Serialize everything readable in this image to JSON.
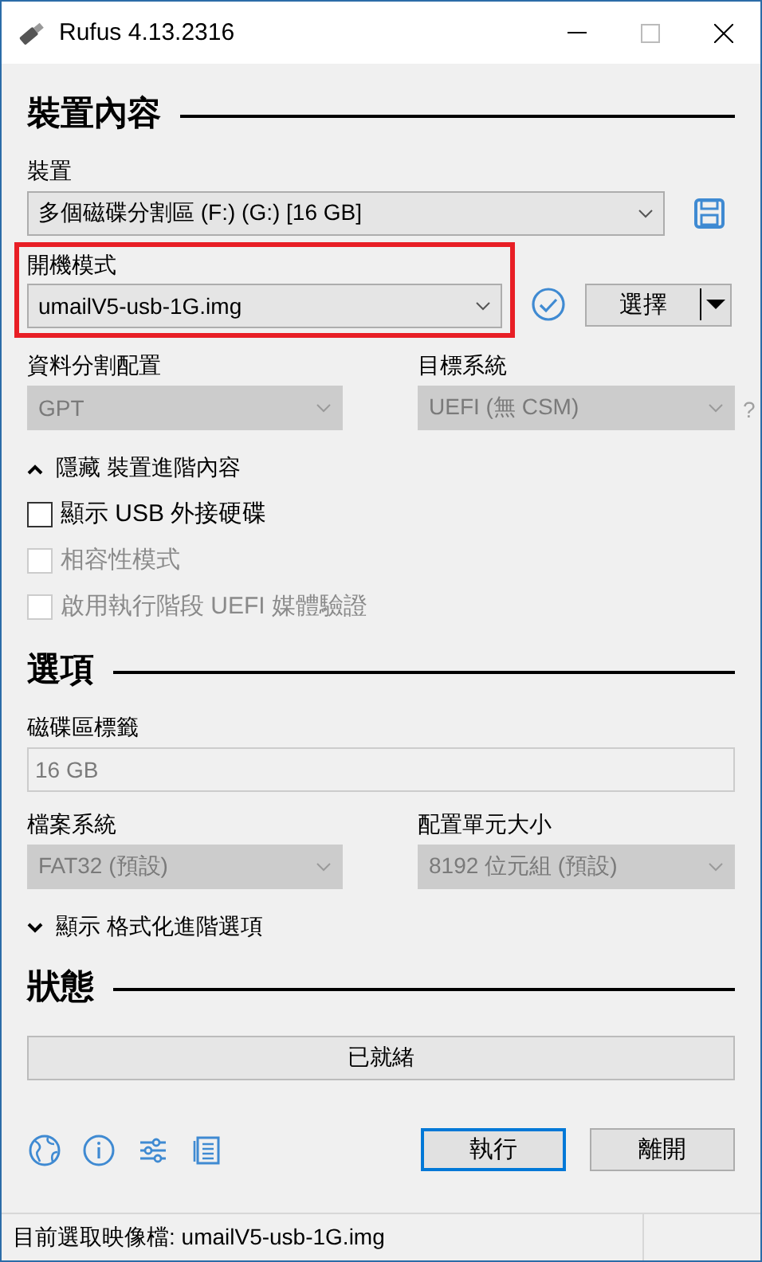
{
  "window": {
    "title": "Rufus 4.13.2316"
  },
  "drive_properties": {
    "heading": "裝置內容",
    "device": {
      "label": "裝置",
      "value": "多個磁碟分割區 (F:) (G:) [16 GB]"
    },
    "boot_selection": {
      "label": "開機模式",
      "value": "umailV5-usb-1G.img",
      "highlighted": true,
      "button": "選擇"
    },
    "partition_scheme": {
      "label": "資料分割配置",
      "value": "GPT",
      "disabled": true
    },
    "target_system": {
      "label": "目標系統",
      "value": "UEFI (無 CSM)",
      "disabled": true,
      "help": "?"
    },
    "advanced_toggle": {
      "label": "隱藏 裝置進階內容",
      "expanded": true
    },
    "options": [
      {
        "label": "顯示 USB 外接硬碟",
        "checked": false,
        "disabled": false
      },
      {
        "label": "相容性模式",
        "checked": false,
        "disabled": true
      },
      {
        "label": "啟用執行階段 UEFI 媒體驗證",
        "checked": false,
        "disabled": true
      }
    ]
  },
  "format_options": {
    "heading": "選項",
    "volume_label": {
      "label": "磁碟區標籤",
      "value": "16 GB",
      "disabled": true
    },
    "file_system": {
      "label": "檔案系統",
      "value": "FAT32 (預設)",
      "disabled": true
    },
    "cluster_size": {
      "label": "配置單元大小",
      "value": "8192 位元組 (預設)",
      "disabled": true
    },
    "advanced_toggle": {
      "label": "顯示 格式化進階選項",
      "expanded": false
    }
  },
  "status": {
    "heading": "狀態",
    "progress": {
      "text": "已就緒",
      "level": 0
    }
  },
  "buttons": [
    {
      "label": "執行",
      "default": true
    },
    {
      "label": "離開",
      "default": false
    }
  ],
  "status_bar": {
    "text": "目前選取映像檔: umailV5-usb-1G.img"
  }
}
